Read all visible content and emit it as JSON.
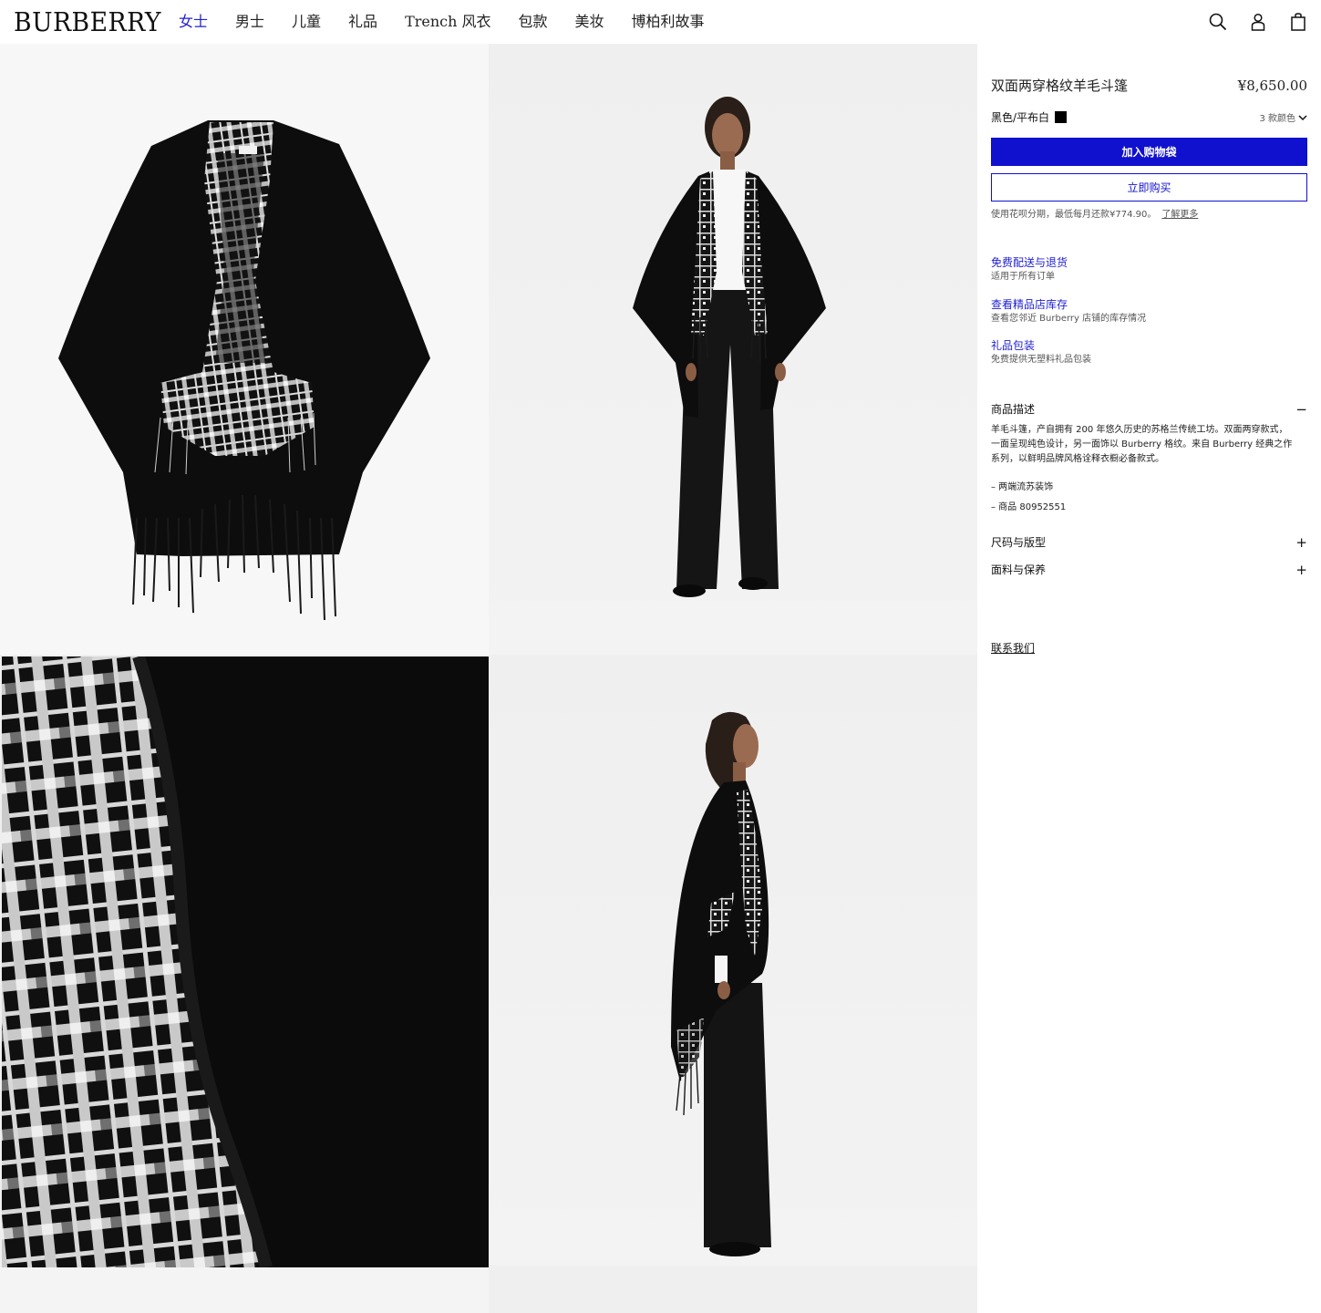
{
  "header": {
    "logo": "BURBERRY",
    "nav": [
      "女士",
      "男士",
      "儿童",
      "礼品",
      "Trench 风衣",
      "包款",
      "美妆",
      "博柏利故事"
    ],
    "active_nav": "女士",
    "icons": [
      "search-icon",
      "account-icon",
      "shopping-bag-icon"
    ]
  },
  "gallery": {
    "images": [
      "cape-flat-lay",
      "model-front-view",
      "fabric-check-closeup",
      "model-side-view"
    ]
  },
  "product": {
    "title": "双面两穿格纹羊毛斗篷",
    "price": "¥8,650.00",
    "color_name": "黑色/平布白",
    "color_swatch": "#000000",
    "color_count": "3 款颜色",
    "add_to_bag": "加入购物袋",
    "buy_now": "立即购买",
    "installment_text": "使用花呗分期，最低每月还款¥774.90。",
    "installment_link": "了解更多"
  },
  "services": [
    {
      "title": "免费配送与退货",
      "subtitle": "适用于所有订单"
    },
    {
      "title": "查看精品店库存",
      "subtitle": "查看您邻近 Burberry 店铺的库存情况"
    },
    {
      "title": "礼品包装",
      "subtitle": "免费提供无塑料礼品包装"
    }
  ],
  "description": {
    "heading": "商品描述",
    "sign": "−",
    "lines": [
      "羊毛斗篷，产自拥有 200 年悠久历史的苏格兰传统工坊。双面两穿款式，",
      "一面呈现纯色设计，另一面饰以 Burberry 格纹。来自 Burberry 经典之作",
      "系列，以鲜明品牌风格诠释衣橱必备款式。"
    ],
    "bullets": [
      "– 两端流苏装饰",
      "– 商品 80952551"
    ]
  },
  "accordions": [
    {
      "label": "尺码与版型",
      "sign": "+"
    },
    {
      "label": "面料与保养",
      "sign": "+"
    }
  ],
  "contact": "联系我们",
  "colors": {
    "accent": "#1010cf",
    "nav_active": "#1f1fd1"
  }
}
